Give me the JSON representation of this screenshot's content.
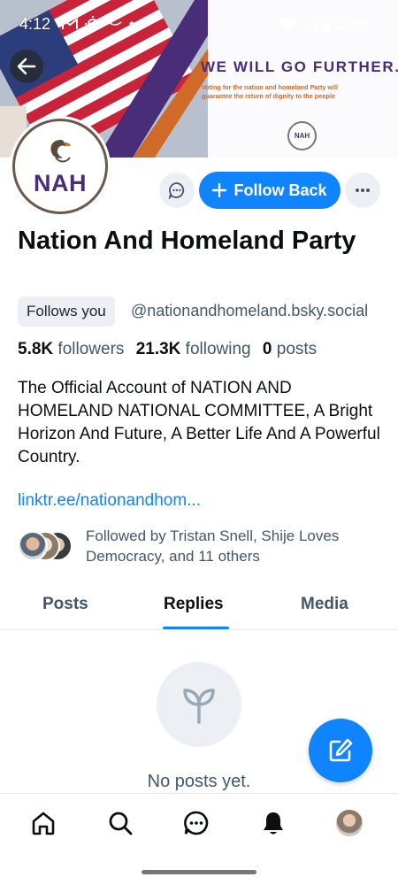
{
  "status_bar": {
    "time": "4:12",
    "battery": "50%"
  },
  "banner": {
    "headline": "WE WILL GO FURTHER.",
    "subtext_line1": "Voting for the nation and homeland Party will",
    "subtext_line2": "guarantee the return of dignity to the people",
    "logo_text": "NAH"
  },
  "profile": {
    "avatar_text": "NAH",
    "display_name": "Nation And Homeland Party",
    "follows_you_label": "Follows you",
    "handle": "@nationandhomeland.bsky.social",
    "followers_count": "5.8K",
    "followers_label": "followers",
    "following_count": "21.3K",
    "following_label": "following",
    "posts_count": "0",
    "posts_label": "posts",
    "bio": "The Official Account of NATION AND HOMELAND NATIONAL COMMITTEE, A Bright Horizon And Future, A Better Life And A Powerful Country.",
    "link": "linktr.ee/nationandhom...",
    "followed_by": "Followed by Tristan Snell, Shije Loves Democracy, and 11 others"
  },
  "actions": {
    "follow_back_label": "Follow Back"
  },
  "tabs": [
    {
      "label": "Posts",
      "active": false
    },
    {
      "label": "Replies",
      "active": true
    },
    {
      "label": "Media",
      "active": false
    }
  ],
  "empty_state": {
    "text": "No posts yet."
  },
  "colors": {
    "accent": "#1083fe",
    "brand_purple": "#4a2d78",
    "brand_orange": "#d06a28"
  }
}
